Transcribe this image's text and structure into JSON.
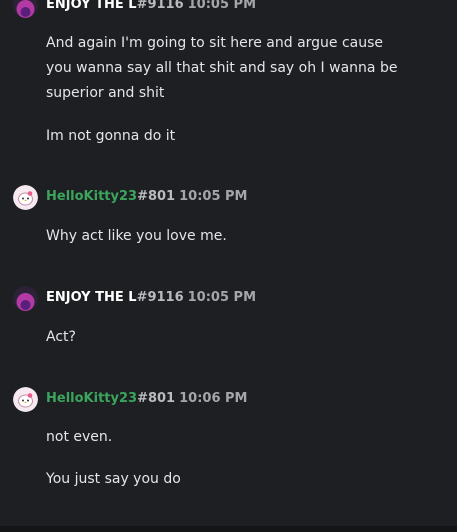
{
  "messages": [
    {
      "user": "ENJOY THE L",
      "discriminator": "#9116",
      "time": "10:05 PM",
      "lines": [
        "And again I'm going to sit here and argue cause you wanna say all that shit and say oh I wanna be superior and shit",
        "Im not gonna do it"
      ]
    },
    {
      "user": "HelloKitty23",
      "discriminator": "#801",
      "time": "10:05 PM",
      "lines": [
        "Why act like you love me."
      ]
    },
    {
      "user": "ENJOY THE L",
      "discriminator": "#9116",
      "time": "10:05 PM",
      "lines": [
        "Act?"
      ]
    },
    {
      "user": "HelloKitty23",
      "discriminator": "#801",
      "time": "10:06 PM",
      "lines": [
        "not even.",
        "You just say you do"
      ]
    }
  ],
  "colors": {
    "background": "#1e1f22",
    "username_default": "#ffffff",
    "username_green": "#3ba55d",
    "timestamp": "#a3a6aa"
  },
  "icons": {
    "avatar_enjoy": "dark-pink-avatar-icon",
    "avatar_kitty": "hello-kitty-avatar-icon"
  }
}
